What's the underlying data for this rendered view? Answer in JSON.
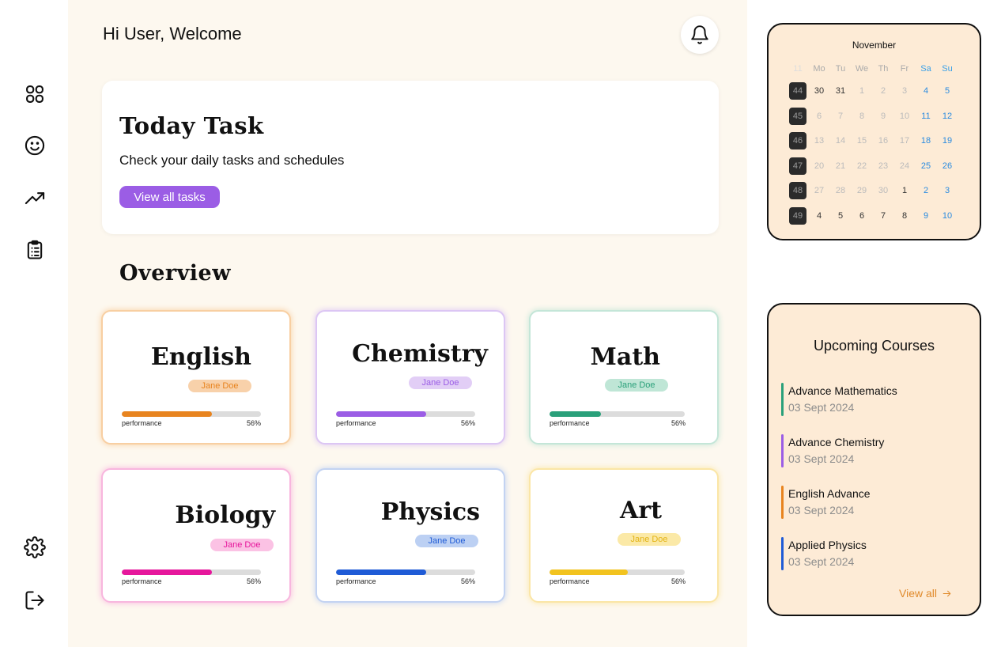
{
  "header": {
    "greeting": "Hi User, Welcome"
  },
  "sidebar": {
    "items": [
      {
        "icon": "dashboard-grid-icon"
      },
      {
        "icon": "smiley-face-icon"
      },
      {
        "icon": "trending-up-icon"
      },
      {
        "icon": "clipboard-list-icon"
      },
      {
        "icon": "gear-icon"
      },
      {
        "icon": "logout-icon"
      }
    ]
  },
  "today_task": {
    "title": "Today Task",
    "subtitle": "Check your daily tasks and schedules",
    "button_label": "View all tasks",
    "button_color": "#9b5de5"
  },
  "overview": {
    "title": "Overview",
    "courses": [
      {
        "name": "English",
        "teacher": "Jane Doe",
        "performance_label": "performance",
        "performance_value": "56%",
        "progress": 0.65,
        "color": "#e8841f",
        "badge_bg": "#f8d1aa",
        "badge_text": "#e8841f",
        "border": "#f8cfa2"
      },
      {
        "name": "Chemistry",
        "teacher": "Jane Doe",
        "performance_label": "performance",
        "performance_value": "56%",
        "progress": 0.65,
        "color": "#9b5de5",
        "badge_bg": "#e2cef6",
        "badge_text": "#9b5de5",
        "border": "#dcc6f4"
      },
      {
        "name": "Math",
        "teacher": "Jane Doe",
        "performance_label": "performance",
        "performance_value": "56%",
        "progress": 0.38,
        "color": "#2aa07a",
        "badge_bg": "#bfe6d6",
        "badge_text": "#2aa07a",
        "border": "#c4e6d8"
      },
      {
        "name": "Biology",
        "teacher": "Jane Doe",
        "performance_label": "performance",
        "performance_value": "56%",
        "progress": 0.65,
        "color": "#e6179c",
        "badge_bg": "#fbc2e4",
        "badge_text": "#e6179c",
        "border": "#f8b6de"
      },
      {
        "name": "Physics",
        "teacher": "Jane Doe",
        "performance_label": "performance",
        "performance_value": "56%",
        "progress": 0.65,
        "color": "#1f5bd6",
        "badge_bg": "#bcd0f3",
        "badge_text": "#1f5bd6",
        "border": "#c3d3f2"
      },
      {
        "name": "Art",
        "teacher": "Jane Doe",
        "performance_label": "performance",
        "performance_value": "56%",
        "progress": 0.58,
        "color": "#f2c31f",
        "badge_bg": "#fbe9a7",
        "badge_text": "#e3b417",
        "border": "#fbe6a6"
      }
    ]
  },
  "calendar": {
    "month": "November",
    "headers": [
      "11",
      "Mo",
      "Tu",
      "We",
      "Th",
      "Fr",
      "Sa",
      "Su"
    ],
    "weeks": [
      {
        "week": "44",
        "days": [
          "30",
          "31",
          "1",
          "2",
          "3",
          "4",
          "5"
        ]
      },
      {
        "week": "45",
        "days": [
          "6",
          "7",
          "8",
          "9",
          "10",
          "11",
          "12"
        ]
      },
      {
        "week": "46",
        "days": [
          "13",
          "14",
          "15",
          "16",
          "17",
          "18",
          "19"
        ]
      },
      {
        "week": "47",
        "days": [
          "20",
          "21",
          "22",
          "23",
          "24",
          "25",
          "26"
        ]
      },
      {
        "week": "48",
        "days": [
          "27",
          "28",
          "29",
          "30",
          "1",
          "2",
          "3"
        ]
      },
      {
        "week": "49",
        "days": [
          "4",
          "5",
          "6",
          "7",
          "8",
          "9",
          "10"
        ]
      }
    ]
  },
  "upcoming": {
    "title": "Upcoming Courses",
    "items": [
      {
        "name": "Advance Mathematics",
        "date": "03 Sept 2024",
        "color": "#2aa07a"
      },
      {
        "name": "Advance Chemistry",
        "date": "03 Sept 2024",
        "color": "#9b5de5"
      },
      {
        "name": "English Advance",
        "date": "03 Sept 2024",
        "color": "#e8841f"
      },
      {
        "name": "Applied Physics",
        "date": "03 Sept 2024",
        "color": "#1f5bd6"
      }
    ],
    "view_all_label": "View all",
    "accent": "#e08a2b"
  }
}
